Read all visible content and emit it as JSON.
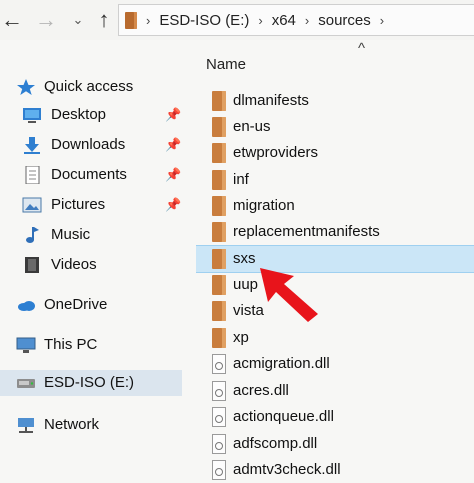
{
  "nav": {
    "back": "←",
    "forward": "→",
    "recent": "⌄",
    "up": "↑"
  },
  "address": {
    "separator": "›",
    "crumbs": [
      "ESD-ISO (E:)",
      "x64",
      "sources"
    ]
  },
  "list_header": {
    "name": "Name",
    "collapse": "^"
  },
  "sidebar": {
    "quick_access": "Quick access",
    "items": [
      {
        "label": "Desktop",
        "icon": "desktop-icon",
        "pinned": true
      },
      {
        "label": "Downloads",
        "icon": "downloads-icon",
        "pinned": true
      },
      {
        "label": "Documents",
        "icon": "documents-icon",
        "pinned": true
      },
      {
        "label": "Pictures",
        "icon": "pictures-icon",
        "pinned": true
      },
      {
        "label": "Music",
        "icon": "music-icon",
        "pinned": false
      },
      {
        "label": "Videos",
        "icon": "videos-icon",
        "pinned": false
      }
    ],
    "onedrive": "OneDrive",
    "this_pc": "This PC",
    "drive": "ESD-ISO (E:)",
    "network": "Network",
    "pin_glyph": "📌"
  },
  "files": [
    {
      "name": "dlmanifests",
      "type": "folder"
    },
    {
      "name": "en-us",
      "type": "folder"
    },
    {
      "name": "etwproviders",
      "type": "folder"
    },
    {
      "name": "inf",
      "type": "folder"
    },
    {
      "name": "migration",
      "type": "folder"
    },
    {
      "name": "replacementmanifests",
      "type": "folder"
    },
    {
      "name": "sxs",
      "type": "folder",
      "selected": true
    },
    {
      "name": "uup",
      "type": "folder"
    },
    {
      "name": "vista",
      "type": "folder"
    },
    {
      "name": "xp",
      "type": "folder"
    },
    {
      "name": "acmigration.dll",
      "type": "dll"
    },
    {
      "name": "acres.dll",
      "type": "dll"
    },
    {
      "name": "actionqueue.dll",
      "type": "dll"
    },
    {
      "name": "adfscomp.dll",
      "type": "dll"
    },
    {
      "name": "admtv3check.dll",
      "type": "dll"
    }
  ],
  "colors": {
    "folder": "#c97d3d",
    "selection": "#cbe6f7",
    "arrow": "#e8141b"
  }
}
